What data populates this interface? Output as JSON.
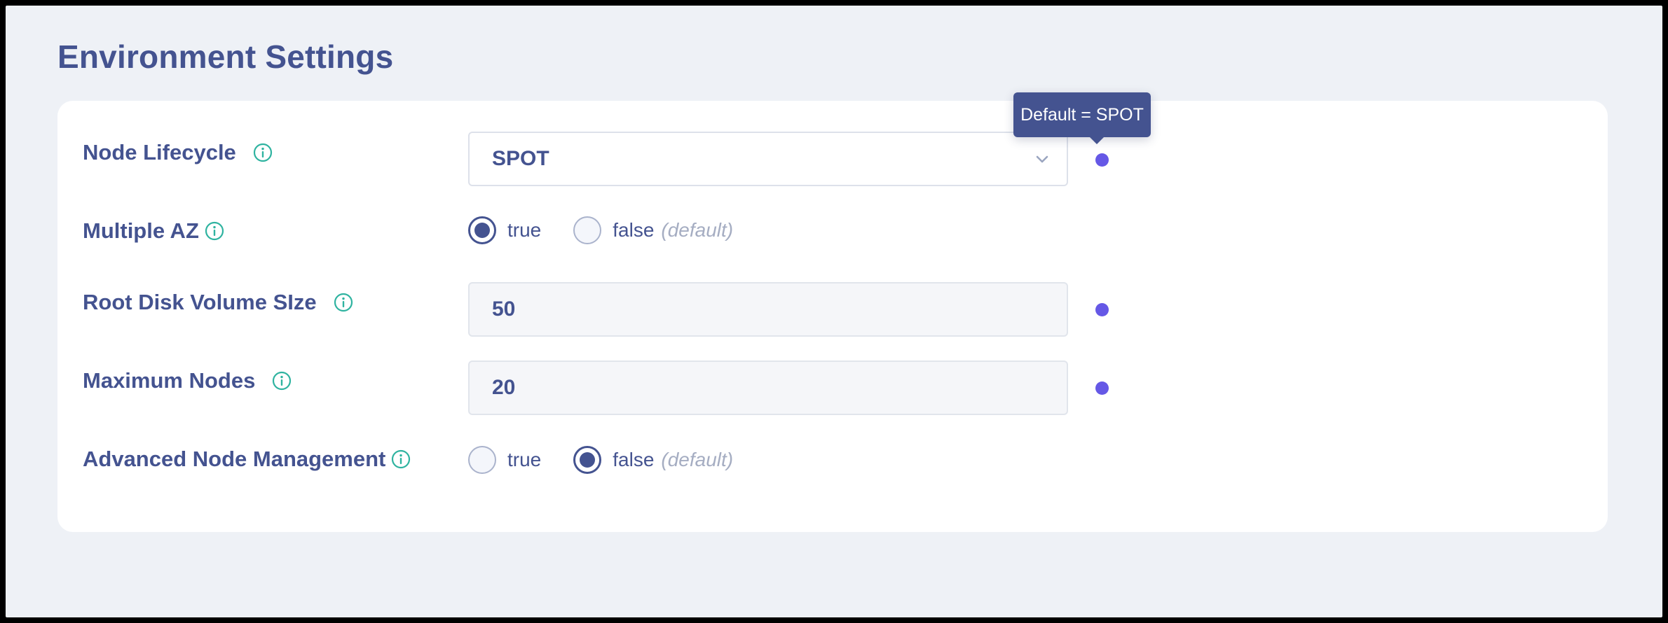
{
  "page": {
    "title": "Environment Settings"
  },
  "settings": {
    "node_lifecycle": {
      "label": "Node Lifecycle",
      "value": "SPOT",
      "tooltip": "Default = SPOT",
      "info_icon": "info-icon",
      "dropdown_icon": "chevron-down-icon"
    },
    "multiple_az": {
      "label": "Multiple AZ",
      "info_icon": "info-icon",
      "options": [
        {
          "label": "true",
          "hint": "",
          "selected": true
        },
        {
          "label": "false",
          "hint": "(default)",
          "selected": false
        }
      ]
    },
    "root_disk_volume_size": {
      "label": "Root Disk Volume SIze",
      "value": "50",
      "info_icon": "info-icon"
    },
    "maximum_nodes": {
      "label": "Maximum Nodes",
      "value": "20",
      "info_icon": "info-icon"
    },
    "advanced_node_management": {
      "label": "Advanced Node Management",
      "info_icon": "info-icon",
      "options": [
        {
          "label": "true",
          "hint": "",
          "selected": false
        },
        {
          "label": "false",
          "hint": "(default)",
          "selected": true
        }
      ]
    }
  },
  "colors": {
    "background": "#eef1f6",
    "card": "#ffffff",
    "text_primary": "#445390",
    "info_icon": "#2fb3a0",
    "modified_dot": "#6558e6",
    "hint_text": "#a5adc2"
  }
}
